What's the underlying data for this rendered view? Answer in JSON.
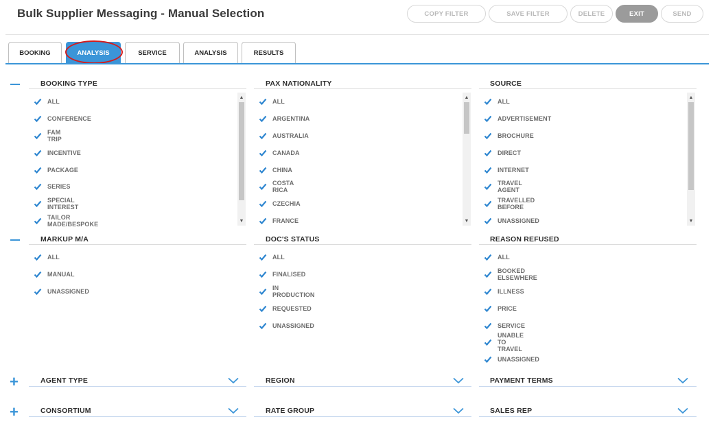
{
  "title": "Bulk Supplier Messaging - Manual Selection",
  "toolbar": {
    "copy_filter": "COPY FILTER",
    "save_filter": "SAVE FILTER",
    "delete": "DELETE",
    "exit": "EXIT",
    "send": "SEND"
  },
  "tabs": [
    "BOOKING",
    "ANALYSIS",
    "SERVICE",
    "ANALYSIS",
    "RESULTS"
  ],
  "active_tab_index": 1,
  "colors": {
    "accent": "#3b95d8",
    "highlight": "#d51b1b"
  },
  "sections": {
    "booking_type": {
      "title": "BOOKING TYPE",
      "items": [
        "ALL",
        "CONFERENCE",
        "FAM TRIP",
        "INCENTIVE",
        "PACKAGE",
        "SERIES",
        "SPECIAL INTEREST",
        "TAILOR MADE/BESPOKE"
      ]
    },
    "pax_nationality": {
      "title": "PAX NATIONALITY",
      "items": [
        "ALL",
        "ARGENTINA",
        "AUSTRALIA",
        "CANADA",
        "CHINA",
        "COSTA RICA",
        "CZECHIA",
        "FRANCE"
      ]
    },
    "source": {
      "title": "SOURCE",
      "items": [
        "ALL",
        "ADVERTISEMENT",
        "BROCHURE",
        "DIRECT",
        "INTERNET",
        "TRAVEL AGENT",
        "TRAVELLED BEFORE",
        "UNASSIGNED"
      ]
    },
    "markup": {
      "title": "MARKUP M/A",
      "items": [
        "ALL",
        "MANUAL",
        "UNASSIGNED"
      ]
    },
    "docs_status": {
      "title": "DOC'S STATUS",
      "items": [
        "ALL",
        "FINALISED",
        "IN PRODUCTION",
        "REQUESTED",
        "UNASSIGNED"
      ]
    },
    "reason_refused": {
      "title": "REASON REFUSED",
      "items": [
        "ALL",
        "BOOKED ELSEWHERE",
        "ILLNESS",
        "PRICE",
        "SERVICE",
        "UNABLE TO TRAVEL",
        "UNASSIGNED"
      ]
    },
    "agent_type": {
      "title": "AGENT TYPE"
    },
    "region": {
      "title": "REGION"
    },
    "payment_terms": {
      "title": "PAYMENT TERMS"
    },
    "consortium": {
      "title": "CONSORTIUM"
    },
    "rate_group": {
      "title": "RATE GROUP"
    },
    "sales_rep": {
      "title": "SALES REP"
    }
  }
}
